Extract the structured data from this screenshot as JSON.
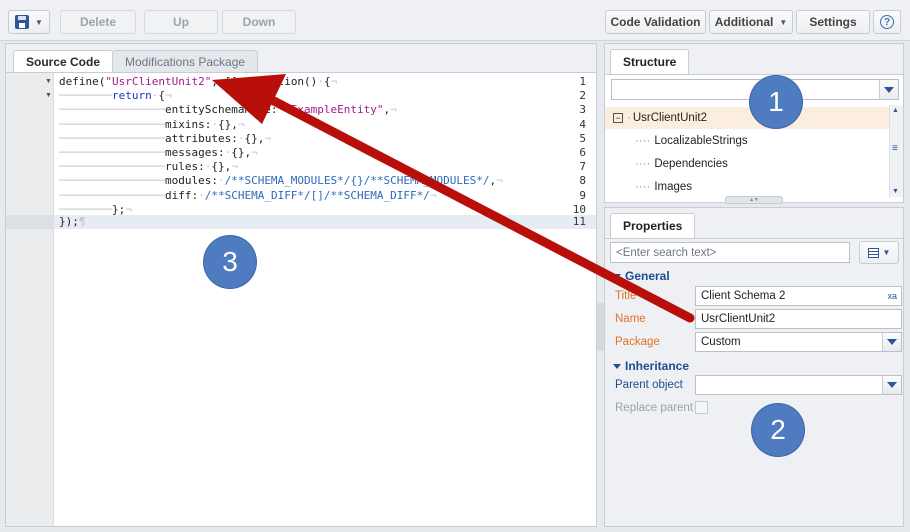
{
  "toolbar": {
    "save_icon": "save-icon",
    "delete": "Delete",
    "up": "Up",
    "down": "Down",
    "code_validation": "Code Validation",
    "additional": "Additional",
    "settings": "Settings",
    "help_icon": "help-icon"
  },
  "editor": {
    "tabs": [
      "Source Code",
      "Modifications Package"
    ],
    "line_numbers": [
      "1",
      "2",
      "3",
      "4",
      "5",
      "6",
      "7",
      "8",
      "9",
      "10",
      "11"
    ],
    "fold_markers": [
      "▼",
      "▼"
    ]
  },
  "structure": {
    "tab": "Structure",
    "search_value": "",
    "tree": {
      "root": "UsrClientUnit2",
      "children": [
        "LocalizableStrings",
        "Dependencies",
        "Images"
      ]
    }
  },
  "properties": {
    "tab": "Properties",
    "search_placeholder": "<Enter search text>",
    "general": {
      "title": "General",
      "title_label": "Title",
      "title_value": "Client Schema 2",
      "name_label": "Name",
      "name_value": "UsrClientUnit2",
      "package_label": "Package",
      "package_value": "Custom"
    },
    "inheritance": {
      "title": "Inheritance",
      "parent_label": "Parent object",
      "parent_value": "",
      "replace_label": "Replace parent"
    }
  },
  "annotations": {
    "badge_1": "1",
    "badge_2": "2",
    "badge_3": "3",
    "arrow_color": "#b80f0a"
  },
  "colors": {
    "accent": "#1d4e8f",
    "required": "#e0732a",
    "badge": "#4f7bc0"
  }
}
